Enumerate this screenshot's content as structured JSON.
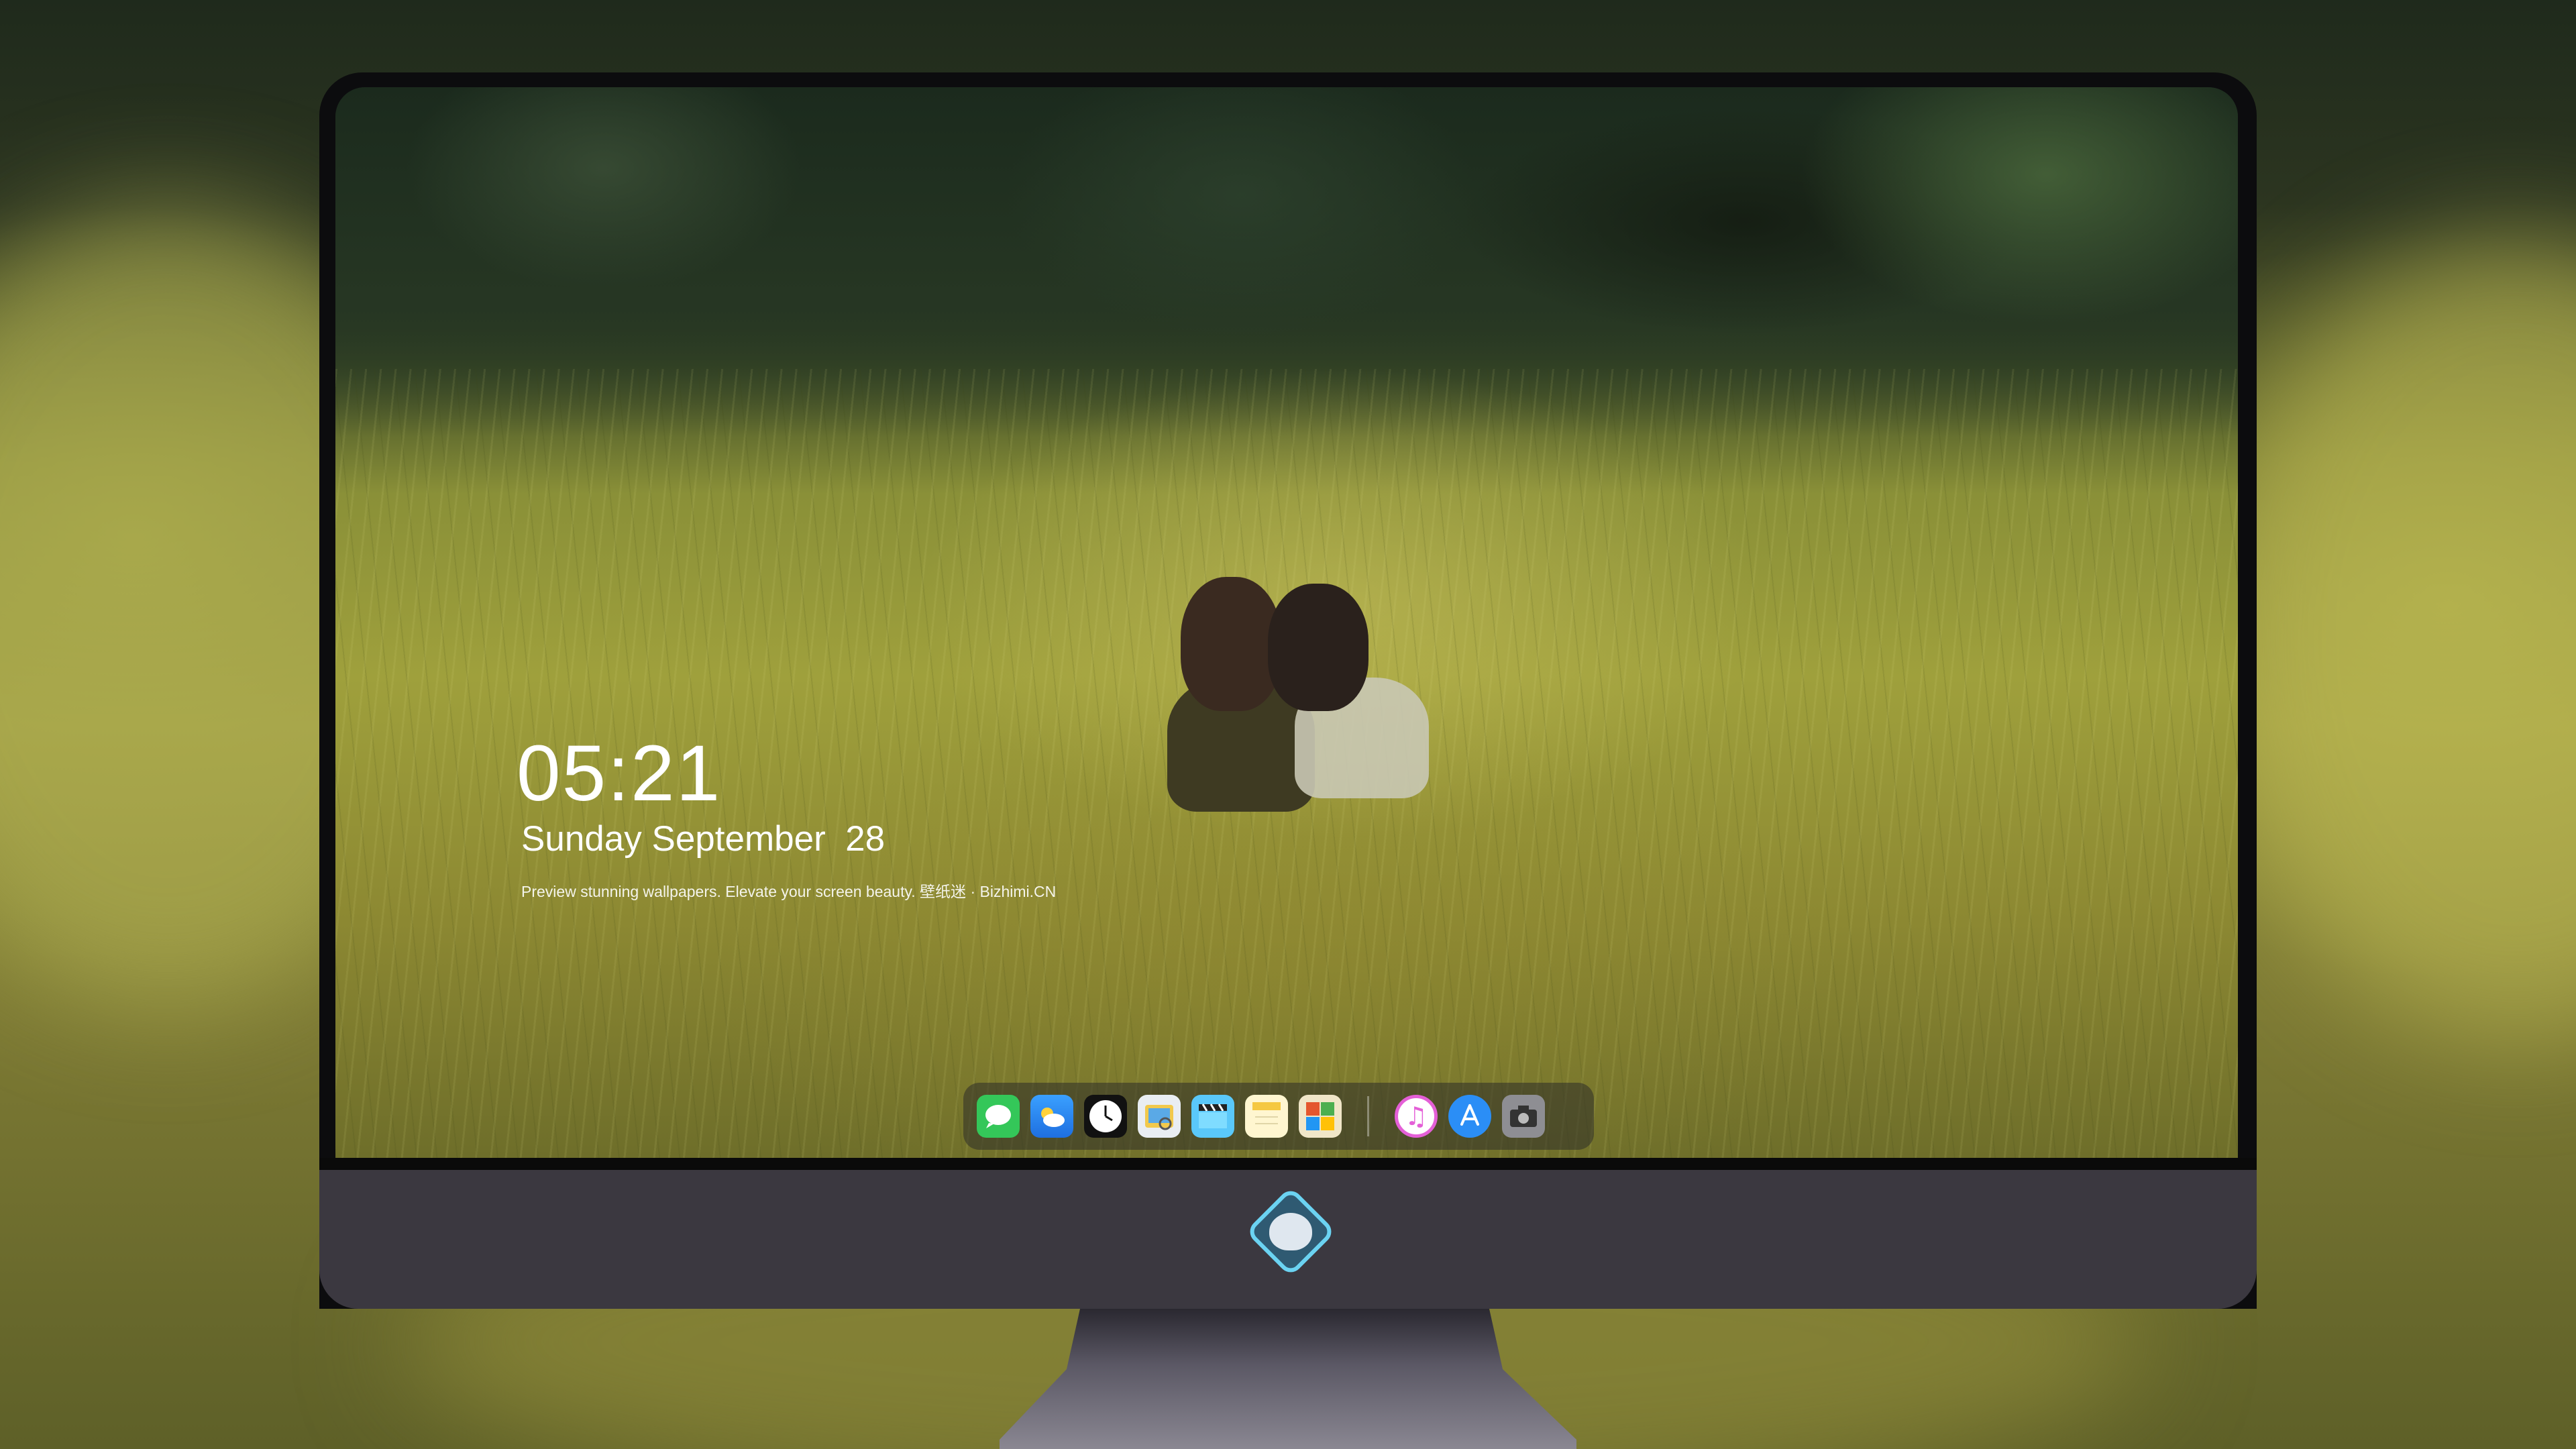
{
  "lock_screen": {
    "time": "05:21",
    "date": "Sunday September  28",
    "tagline": "Preview stunning wallpapers. Elevate your screen beauty. 壁纸迷 · Bizhimi.CN"
  },
  "dock": {
    "apps": [
      {
        "name": "messages-icon",
        "glyph": "💬",
        "color": "#34c759"
      },
      {
        "name": "weather-icon",
        "glyph": "⛅",
        "color": "#2f8ff7"
      },
      {
        "name": "clock-icon",
        "glyph": "🕓",
        "color": "#111111"
      },
      {
        "name": "preview-icon",
        "glyph": "🖼",
        "color": "#e7c64a"
      },
      {
        "name": "clapperboard-icon",
        "glyph": "🎬",
        "color": "#5ac8fa"
      },
      {
        "name": "notes-icon",
        "glyph": "📝",
        "color": "#f5d15a"
      },
      {
        "name": "photo-booth-icon",
        "glyph": "🗂",
        "color": "#d9a441"
      },
      {
        "name": "itunes-icon",
        "glyph": "♫",
        "color": "#e45fd7"
      },
      {
        "name": "app-store-icon",
        "glyph": "Ⓐ",
        "color": "#2b8ef6"
      },
      {
        "name": "camera-icon",
        "glyph": "📷",
        "color": "#8e8e93"
      }
    ]
  },
  "monitor": {
    "logo": "mascot-logo-icon"
  }
}
